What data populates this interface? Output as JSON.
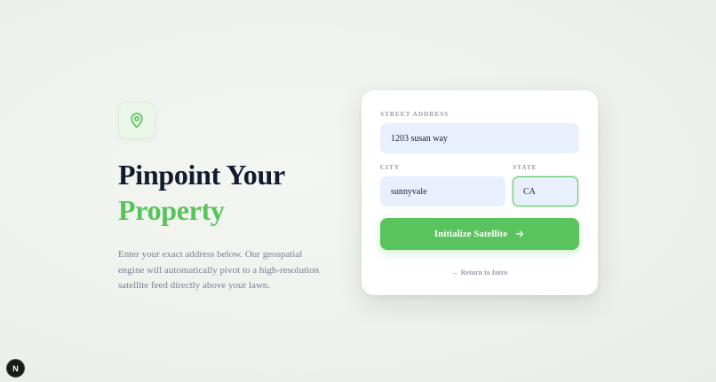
{
  "hero": {
    "icon": "map-pin-icon",
    "title_line1": "Pinpoint Your",
    "title_line2": "Property",
    "description": "Enter your exact address below. Our geospatial engine will automatically pivot to a high-resolution satellite feed directly above your lawn."
  },
  "form": {
    "street_label": "STREET ADDRESS",
    "street_value": "1203 susan way",
    "city_label": "CITY",
    "city_value": "sunnyvale",
    "state_label": "STATE",
    "state_value": "CA",
    "submit_label": "Initialize Satellite",
    "back_label": "← Return to Intro"
  },
  "badge": {
    "label": "N"
  },
  "colors": {
    "accent": "#58c35d",
    "heading": "#141a2e",
    "input_bg": "#e8effd"
  }
}
